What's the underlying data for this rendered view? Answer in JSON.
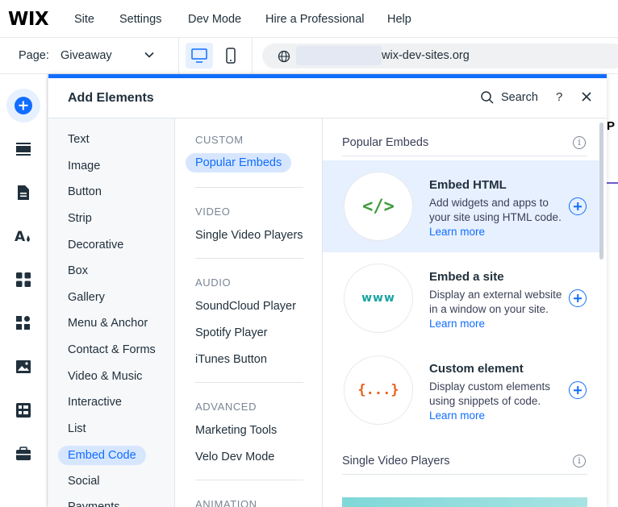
{
  "topbar": {
    "logo": "WIX",
    "menu": [
      "Site",
      "Settings",
      "Dev Mode",
      "Hire a Professional",
      "Help"
    ]
  },
  "subbar": {
    "page_label": "Page:",
    "page_value": "Giveaway",
    "url": "wix-dev-sites.org"
  },
  "panel": {
    "title": "Add Elements",
    "search_label": "Search",
    "help": "?"
  },
  "categories": [
    "Text",
    "Image",
    "Button",
    "Strip",
    "Decorative",
    "Box",
    "Gallery",
    "Menu & Anchor",
    "Contact & Forms",
    "Video & Music",
    "Interactive",
    "List",
    "Embed Code",
    "Social",
    "Payments"
  ],
  "selected_category": "Embed Code",
  "subcategories": {
    "custom_head": "CUSTOM",
    "custom": [
      "Popular Embeds"
    ],
    "video_head": "VIDEO",
    "video": [
      "Single Video Players"
    ],
    "audio_head": "AUDIO",
    "audio": [
      "SoundCloud Player",
      "Spotify Player",
      "iTunes Button"
    ],
    "advanced_head": "ADVANCED",
    "advanced": [
      "Marketing Tools",
      "Velo Dev Mode"
    ],
    "animation_head": "ANIMATION"
  },
  "main": {
    "section1": "Popular Embeds",
    "section2": "Single Video Players",
    "info": "i",
    "items": [
      {
        "icon": "</>",
        "title": "Embed HTML",
        "desc": "Add widgets and apps to your site using HTML code.",
        "link": "Learn more",
        "icon_color": "#3f9a3a"
      },
      {
        "icon": "www",
        "title": "Embed a site",
        "desc": "Display an external website in a window on your site.",
        "link": "Learn more",
        "icon_color": "#1aa3a3"
      },
      {
        "icon": "{...}",
        "title": "Custom element",
        "desc": "Display custom elements using snippets of code.",
        "link": "Learn more",
        "icon_color": "#e8611a"
      }
    ]
  },
  "background_page": {
    "fragment": "P"
  },
  "colors": {
    "accent": "#116dff",
    "selected_bg": "#d6e6fe"
  }
}
